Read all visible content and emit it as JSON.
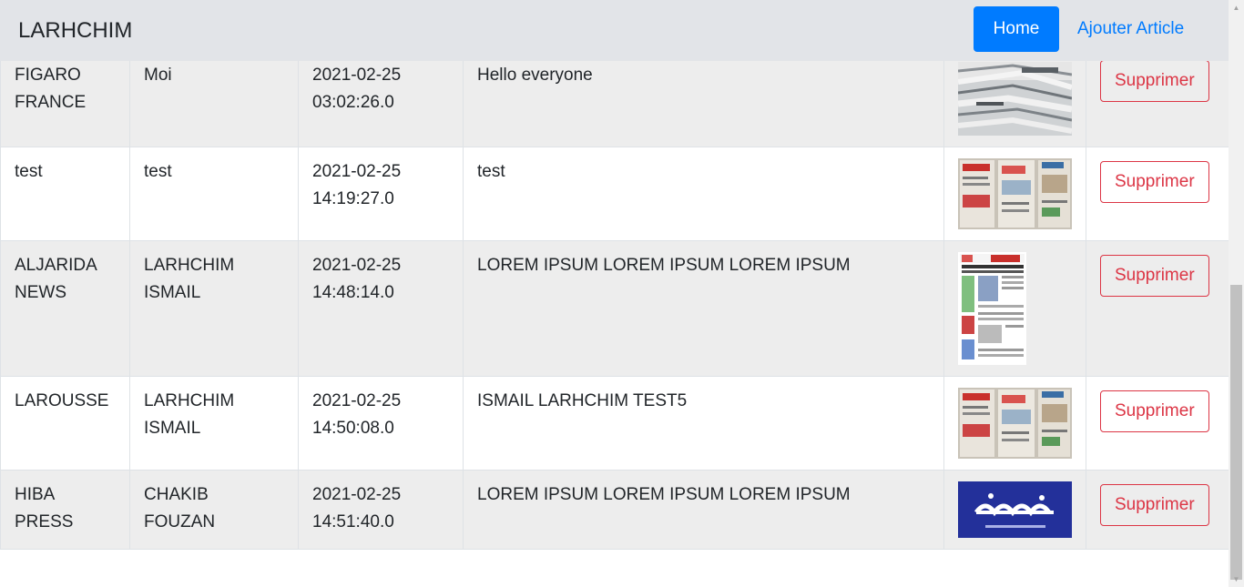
{
  "navbar": {
    "brand": "LARHCHIM",
    "home_label": "Home",
    "add_label": "Ajouter Article"
  },
  "articles": [
    {
      "source": "FIGARO FRANCE",
      "author": "Moi",
      "date": "2021-02-25",
      "time": "03:02:26.0",
      "content": "Hello everyone",
      "thumb": "newspaper-stack-image",
      "delete_label": "Supprimer"
    },
    {
      "source": "test",
      "author": "test",
      "date": "2021-02-25",
      "time": "14:19:27.0",
      "content": "test",
      "thumb": "arabic-newspapers-image",
      "delete_label": "Supprimer"
    },
    {
      "source": "ALJARIDA NEWS",
      "author": "LARHCHIM ISMAIL",
      "date": "2021-02-25",
      "time": "14:48:14.0",
      "content": "LOREM IPSUM LOREM IPSUM LOREM IPSUM",
      "thumb": "newspaper-front-page-image",
      "delete_label": "Supprimer"
    },
    {
      "source": "LAROUSSE",
      "author": "LARHCHIM ISMAIL",
      "date": "2021-02-25",
      "time": "14:50:08.0",
      "content": "ISMAIL LARHCHIM TEST5",
      "thumb": "arabic-newspapers-image",
      "delete_label": "Supprimer"
    },
    {
      "source": "HIBA PRESS",
      "author": "CHAKIB FOUZAN",
      "date": "2021-02-25",
      "time": "14:51:40.0",
      "content": "LOREM IPSUM LOREM IPSUM LOREM IPSUM",
      "thumb": "hespress-logo-image",
      "delete_label": "Supprimer"
    }
  ],
  "colors": {
    "primary": "#007bff",
    "danger": "#dc3545",
    "navbar_bg": "#e2e4e8",
    "row_stripe": "#ededed"
  }
}
